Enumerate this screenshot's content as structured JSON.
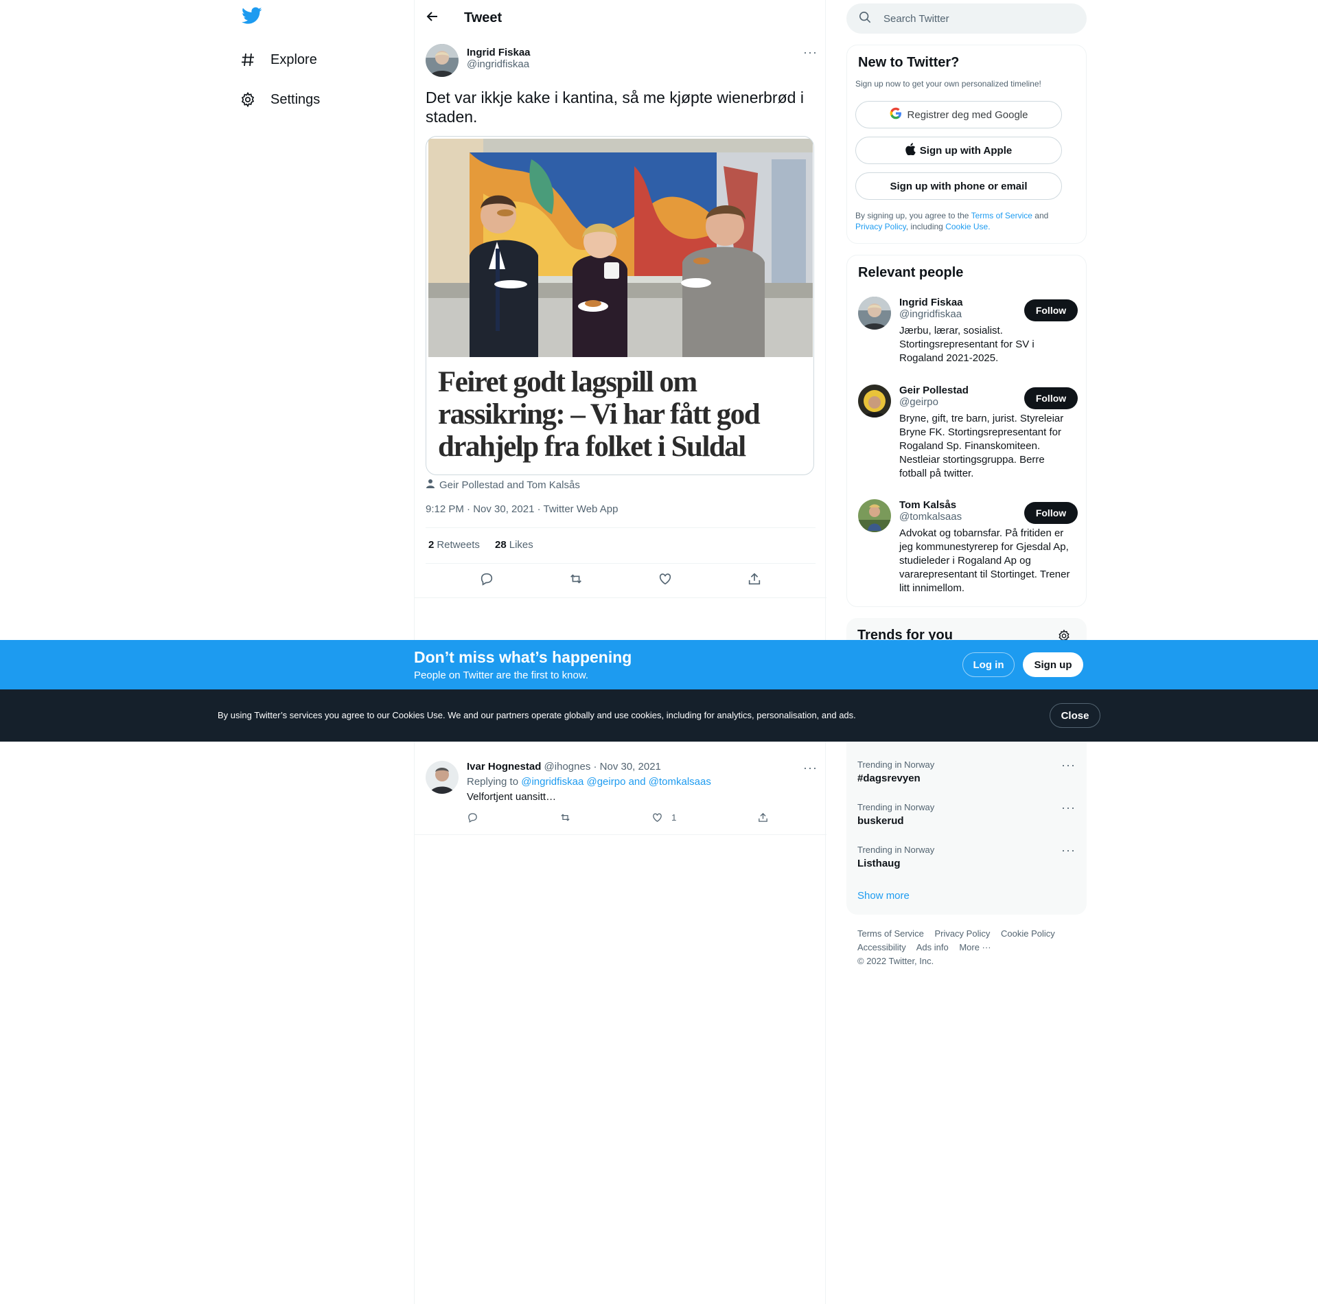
{
  "nav": {
    "items": [
      {
        "label": "Explore",
        "icon": "hashtag-icon"
      },
      {
        "label": "Settings",
        "icon": "gear-icon"
      }
    ]
  },
  "header": {
    "title": "Tweet"
  },
  "tweet": {
    "author_name": "Ingrid Fiskaa",
    "author_handle": "@ingridfiskaa",
    "text": "Det var ikkje kake i kantina, så me kjøpte wienerbrød i staden.",
    "card_headline": "Feiret godt lagspill om rassikring: – Vi har fått god drahjelp fra folket i Suldal",
    "tagged": "Geir Pollestad and Tom Kalsås",
    "meta": "9:12 PM · Nov 30, 2021 · Twitter Web App",
    "retweets_count": "2",
    "retweets_label": "Retweets",
    "likes_count": "28",
    "likes_label": "Likes"
  },
  "reply": {
    "author_name": "Ivar Hognestad",
    "handle_date": "@ihognes · Nov 30, 2021",
    "replying_prefix": "Replying to",
    "replying_to": "@ingridfiskaa @geirpo and @tomkalsaas",
    "text": "Velfortjent uansitt…",
    "like_count": "1"
  },
  "search": {
    "placeholder": "Search Twitter"
  },
  "signup": {
    "title": "New to Twitter?",
    "subtitle": "Sign up now to get your own personalized timeline!",
    "google_label": "Registrer deg med Google",
    "apple_label": "Sign up with Apple",
    "phone_label": "Sign up with phone or email",
    "legal_1": "By signing up, you agree to the",
    "terms_link": "Terms of Service",
    "legal_2": "and",
    "privacy_link": "Privacy Policy",
    "legal_3": ", including",
    "cookie_link": "Cookie Use."
  },
  "relevant": {
    "title": "Relevant people",
    "follow_label": "Follow",
    "people": [
      {
        "name": "Ingrid Fiskaa",
        "handle": "@ingridfiskaa",
        "bio": "Jærbu, lærar, sosialist. Stortingsrepresentant for SV i Rogaland 2021-2025."
      },
      {
        "name": "Geir Pollestad",
        "handle": "@geirpo",
        "bio": "Bryne, gift, tre barn, jurist. Styreleiar Bryne FK. Stortingsrepresentant for Rogaland Sp. Finanskomiteen. Nestleiar stortingsgruppa. Berre fotball på twitter."
      },
      {
        "name": "Tom Kalsås",
        "handle": "@tomkalsaas",
        "bio": "Advokat og tobarnsfar. På fritiden er jeg kommunestyrerep for Gjesdal Ap, studieleder i Rogaland Ap og vararepresentant til Stortinget. Trener litt innimellom."
      }
    ]
  },
  "trends": {
    "title": "Trends for you",
    "items": [
      {
        "context": "Trending in Norway",
        "name": "#dagsrevyen"
      },
      {
        "context": "Trending in Norway",
        "name": "buskerud"
      },
      {
        "context": "Trending in Norway",
        "name": "Listhaug"
      }
    ],
    "show_more": "Show more"
  },
  "footer": {
    "links": [
      "Terms of Service",
      "Privacy Policy",
      "Cookie Policy",
      "Accessibility",
      "Ads info",
      "More ···"
    ],
    "copyright": "© 2022 Twitter, Inc."
  },
  "banner": {
    "headline": "Don’t miss what’s happening",
    "sub": "People on Twitter are the first to know.",
    "login_label": "Log in",
    "signup_label": "Sign up"
  },
  "cookie": {
    "text": "By using Twitter’s services you agree to our Cookies Use. We and our partners operate globally and use cookies, including for analytics, personalisation, and ads.",
    "close_label": "Close"
  },
  "colors": {
    "accent": "#1d9bf0",
    "dark": "#0f1419",
    "muted": "#536471",
    "cookie_bg": "#15202b"
  }
}
